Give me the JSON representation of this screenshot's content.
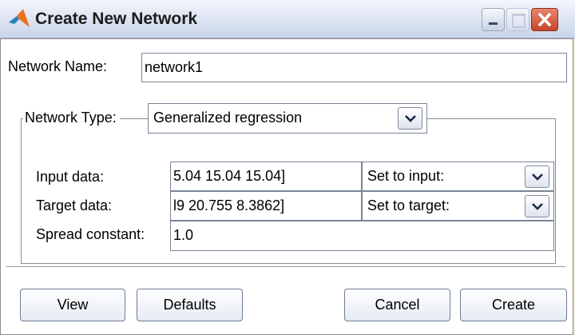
{
  "window": {
    "title": "Create New Network"
  },
  "form": {
    "network_name_label": "Network Name:",
    "network_name_value": "network1",
    "network_type_label": "Network Type:",
    "network_type_value": "Generalized regression",
    "input_data_label": "Input data:",
    "input_data_value": "5.04 15.04 15.04]",
    "input_data_source": "Set to input:",
    "target_data_label": "Target data:",
    "target_data_value": "l9 20.755 8.3862]",
    "target_data_source": "Set to target:",
    "spread_label": "Spread constant:",
    "spread_value": "1.0"
  },
  "buttons": {
    "view": "View",
    "defaults": "Defaults",
    "cancel": "Cancel",
    "create": "Create"
  },
  "icons": {
    "app": "matlab-logo-icon",
    "minimize": "minimize-icon",
    "maximize": "maximize-icon",
    "close": "close-icon",
    "dropdown": "chevron-down-icon"
  },
  "colors": {
    "close_button": "#c6452a",
    "dialog_background": "#ffffff",
    "titlebar": "#dfe6f3"
  }
}
